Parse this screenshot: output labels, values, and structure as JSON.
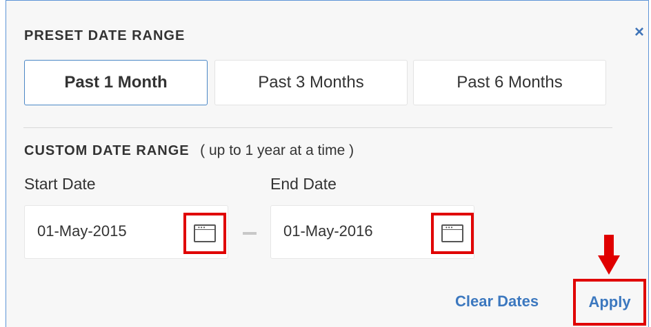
{
  "preset": {
    "title": "PRESET DATE RANGE",
    "close_icon": "×",
    "options": [
      {
        "label": "Past 1 Month",
        "active": true
      },
      {
        "label": "Past 3 Months",
        "active": false
      },
      {
        "label": "Past 6 Months",
        "active": false
      }
    ]
  },
  "custom": {
    "title": "CUSTOM DATE RANGE",
    "note": "( up to 1 year at a time )",
    "start_label": "Start Date",
    "end_label": "End Date",
    "start_value": "01-May-2015",
    "end_value": "01-May-2016",
    "separator": "–",
    "calendar_icon": "calendar-icon"
  },
  "actions": {
    "clear_label": "Clear Dates",
    "apply_label": "Apply"
  },
  "colors": {
    "accent": "#3c78bf",
    "highlight": "#e00000",
    "panel_bg": "#f7f7f7"
  }
}
